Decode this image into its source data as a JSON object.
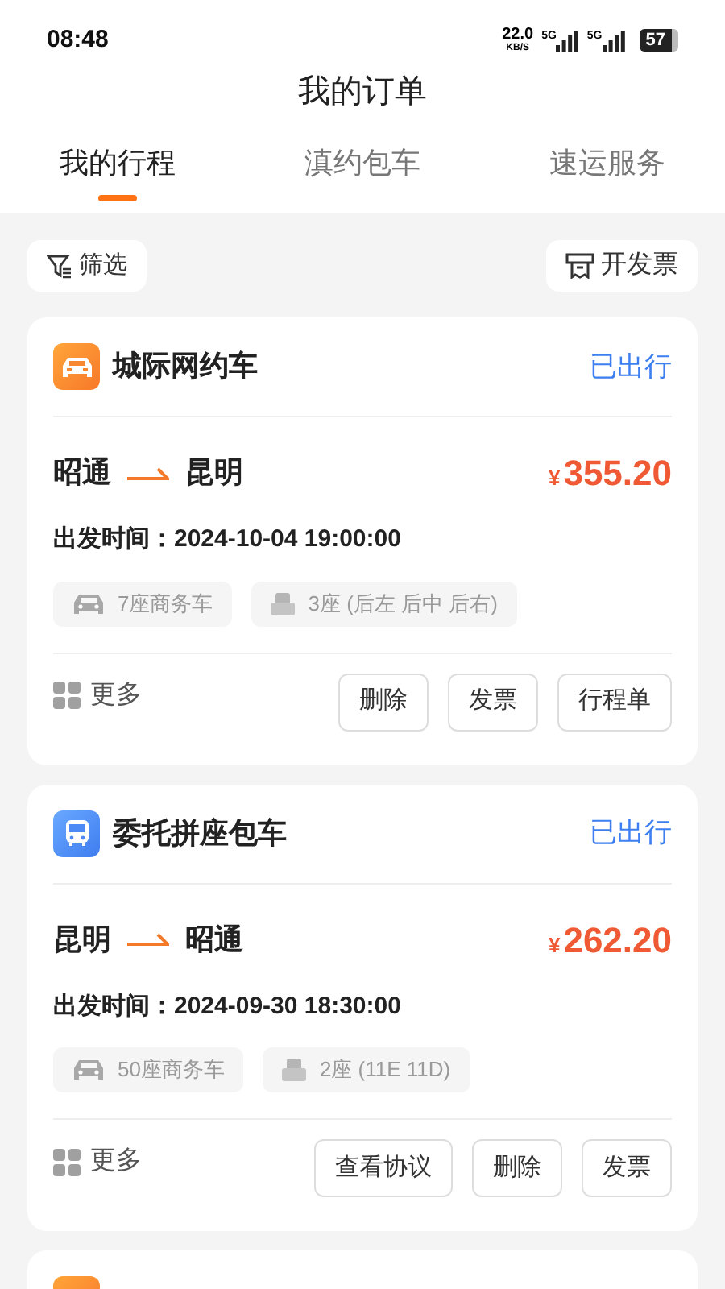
{
  "status_bar": {
    "time": "08:48",
    "speed": "22.0",
    "speed_unit": "KB/S",
    "sims": [
      "5G",
      "5G"
    ],
    "battery": "57"
  },
  "title": "我的订单",
  "tabs": [
    {
      "label": "我的行程",
      "selected": true
    },
    {
      "label": "滇约包车",
      "selected": false
    },
    {
      "label": "速运服务",
      "selected": false
    }
  ],
  "filter_button": "筛选",
  "invoice_button": "开发票",
  "orders": [
    {
      "kind": "car",
      "title": "城际网约车",
      "status": "已出行",
      "from": "昭通",
      "to": "昆明",
      "currency": "¥",
      "price": "355.20",
      "depart_label": "出发时间：",
      "depart_time": "2024-10-04 19:00:00",
      "vehicle": "7座商务车",
      "seats": "3座 (后左 后中 后右)",
      "more": "更多",
      "actions": [
        "删除",
        "发票",
        "行程单"
      ]
    },
    {
      "kind": "bus",
      "title": "委托拼座包车",
      "status": "已出行",
      "from": "昆明",
      "to": "昭通",
      "currency": "¥",
      "price": "262.20",
      "depart_label": "出发时间：",
      "depart_time": "2024-09-30 18:30:00",
      "vehicle": "50座商务车",
      "seats": "2座 (11E 11D)",
      "more": "更多",
      "actions": [
        "查看协议",
        "删除",
        "发票"
      ]
    },
    {
      "kind": "car"
    }
  ]
}
